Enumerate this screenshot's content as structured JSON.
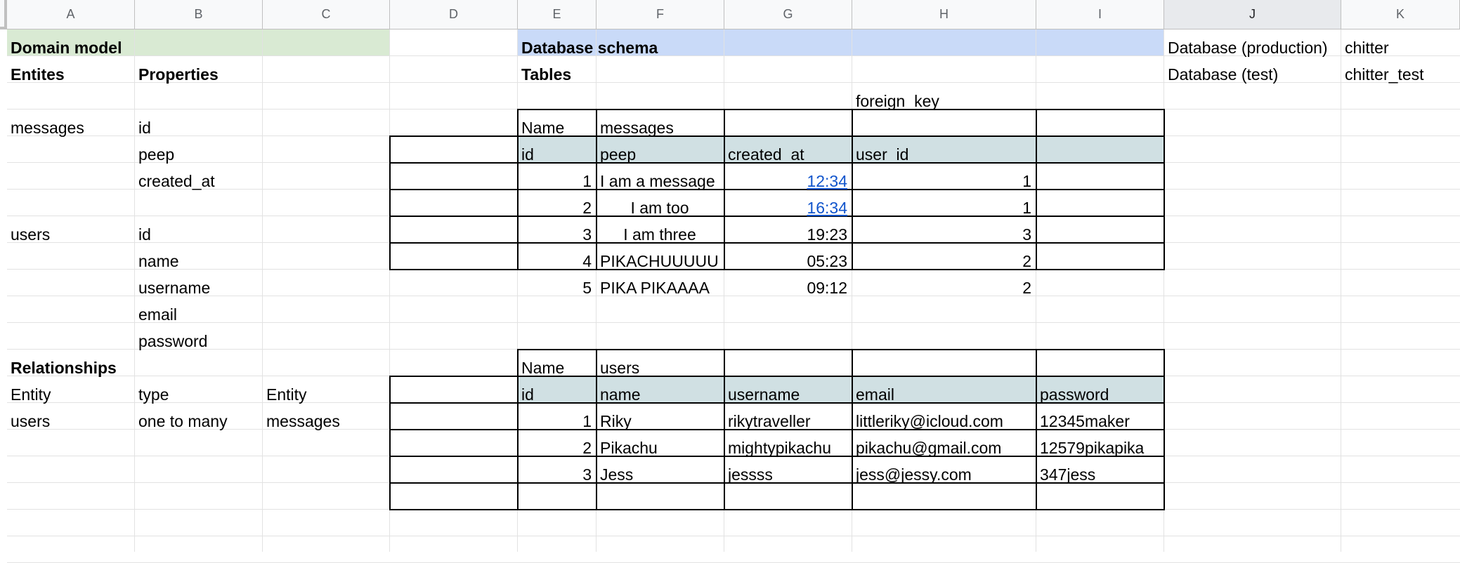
{
  "colors": {
    "domain_model_fill": "#d9ead3",
    "database_schema_fill": "#c9daf8",
    "table_header_fill": "#d0e0e3",
    "link": "#1155cc",
    "header_selected": "#e8eaed"
  },
  "columns": [
    "A",
    "B",
    "C",
    "D",
    "E",
    "F",
    "G",
    "H",
    "I",
    "J",
    "K"
  ],
  "domain": {
    "title": "Domain model",
    "entities_header": "Entites",
    "properties_header": "Properties",
    "messages_entity": "messages",
    "messages_props": [
      "id",
      "peep",
      "created_at"
    ],
    "users_entity": "users",
    "users_props": [
      "id",
      "name",
      "username",
      "email",
      "password"
    ],
    "relationships_title": "Relationships",
    "rel_headers": [
      "Entity",
      "type",
      "Entity"
    ],
    "rel_row": [
      "users",
      "one to many",
      "messages"
    ]
  },
  "schema": {
    "title": "Database schema",
    "tables_label": "Tables",
    "foreign_key_label": "foreign_key",
    "messages_table": {
      "name_label": "Name",
      "name": "messages",
      "columns": [
        "id",
        "peep",
        "created_at",
        "user_id"
      ],
      "rows": [
        [
          "1",
          "I am a message",
          "12:34",
          "1"
        ],
        [
          "2",
          "I am too",
          "16:34",
          "1"
        ],
        [
          "3",
          "I am three",
          "19:23",
          "3"
        ],
        [
          "4",
          "PIKACHUUUUU",
          "05:23",
          "2"
        ],
        [
          "5",
          "PIKA PIKAAAA",
          "09:12",
          "2"
        ]
      ]
    },
    "users_table": {
      "name_label": "Name",
      "name": "users",
      "columns": [
        "id",
        "name",
        "username",
        "email",
        "password"
      ],
      "rows": [
        [
          "1",
          "Riky",
          "rikytraveller",
          "littleriky@icloud.com",
          "12345maker"
        ],
        [
          "2",
          "Pikachu",
          "mightypikachu",
          "pikachu@gmail.com",
          "12579pikapika"
        ],
        [
          "3",
          "Jess",
          "jessss",
          "jess@jessy.com",
          "347jess"
        ]
      ]
    }
  },
  "databases": {
    "production_label": "Database (production)",
    "production_value": "chitter",
    "test_label": "Database (test)",
    "test_value": "chitter_test"
  }
}
